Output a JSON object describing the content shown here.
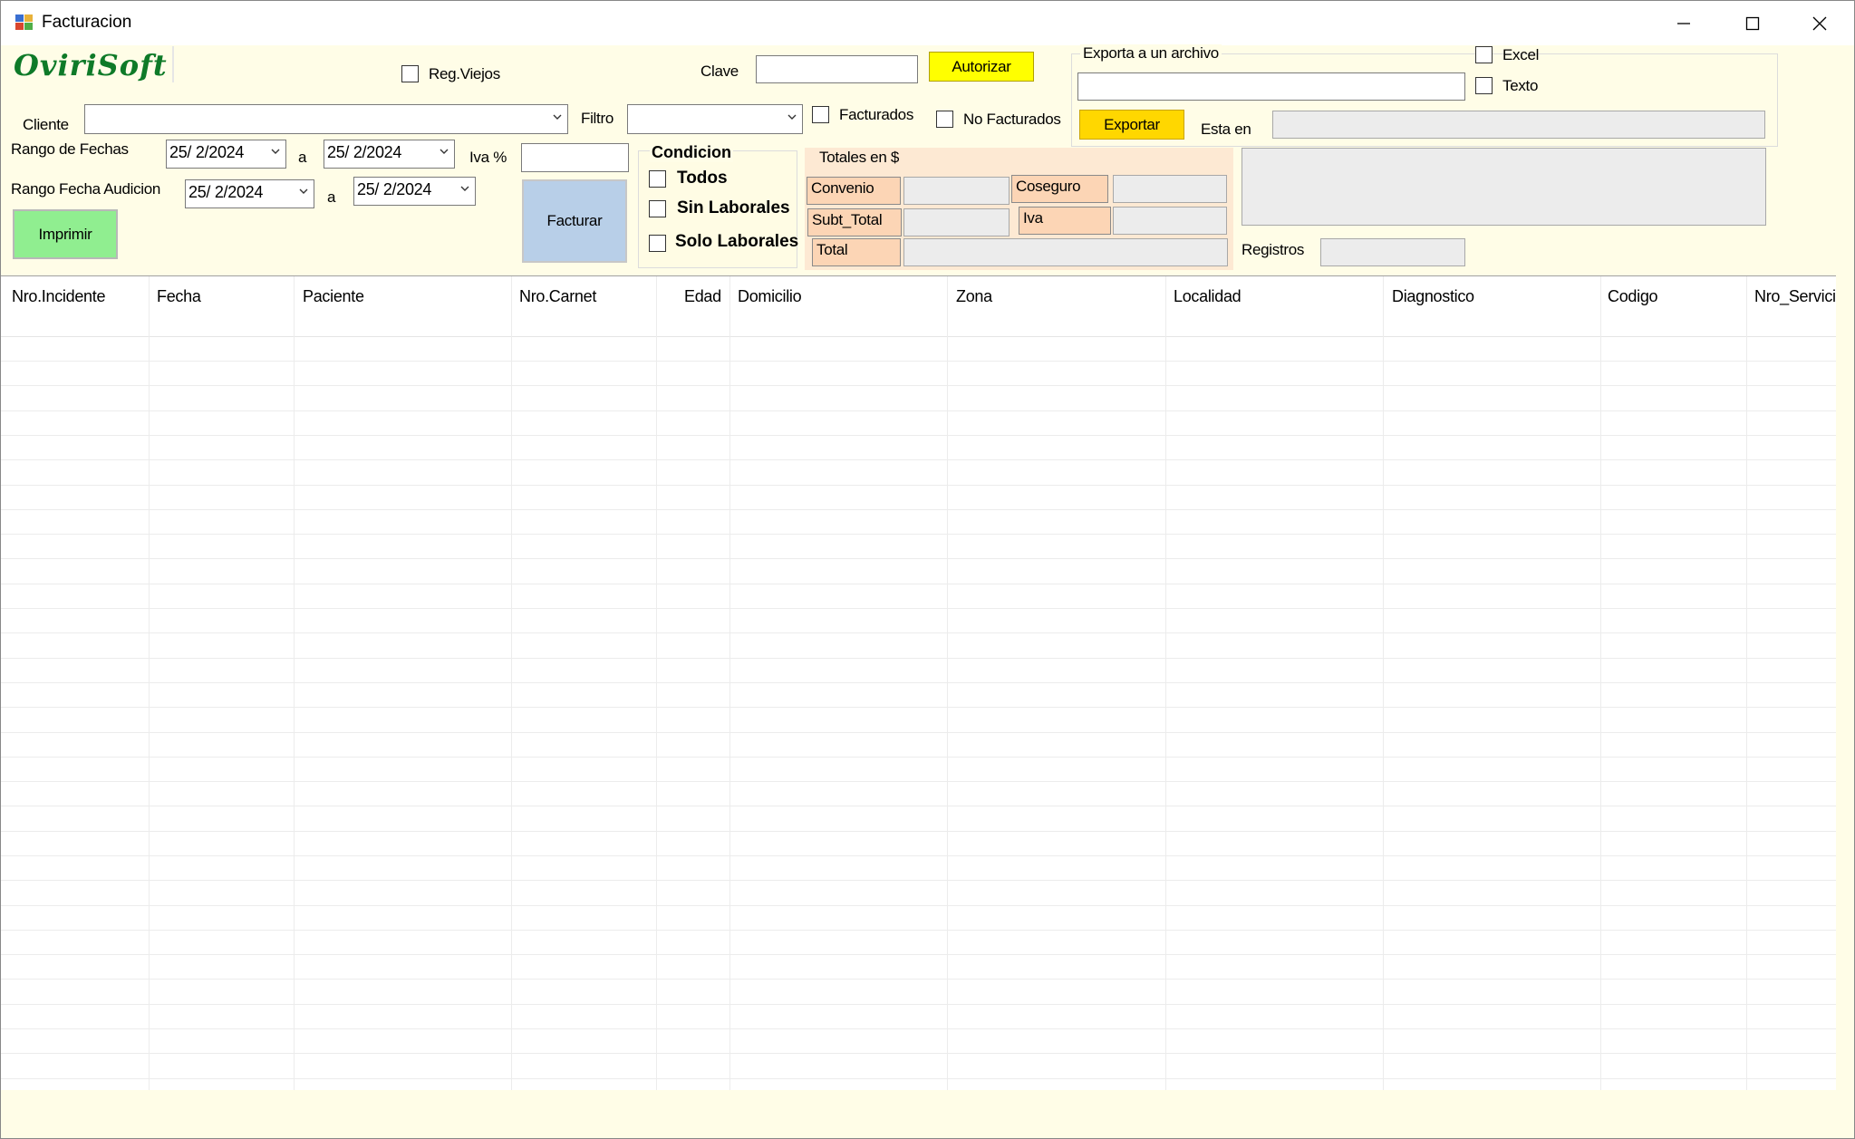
{
  "window": {
    "title": "Facturacion"
  },
  "logo": "OviriSoft",
  "top": {
    "reg_viejos": "Reg.Viejos",
    "clave_label": "Clave",
    "clave_value": "",
    "autorizar": "Autorizar"
  },
  "export": {
    "group_label": "Exporta a un archivo",
    "excel": "Excel",
    "texto": "Texto",
    "path_value": "",
    "exportar": "Exportar",
    "esta_en": "Esta en",
    "esta_en_value": ""
  },
  "filters": {
    "cliente_label": "Cliente",
    "cliente_value": "",
    "filtro_label": "Filtro",
    "filtro_value": "",
    "facturados": "Facturados",
    "no_facturados": "No Facturados",
    "rango_fechas": "Rango de Fechas",
    "fecha_desde": "25/  2/2024",
    "a": "a",
    "fecha_hasta": "25/  2/2024",
    "iva_pct_label": "Iva %",
    "iva_pct_value": "",
    "rango_audicion": "Rango Fecha Audicion",
    "aud_desde": "25/  2/2024",
    "aud_hasta": "25/  2/2024",
    "imprimir": "Imprimir",
    "facturar": "Facturar"
  },
  "condicion": {
    "title": "Condicion",
    "todos": "Todos",
    "sin_laborales": "Sin Laborales",
    "solo_laborales": "Solo Laborales"
  },
  "totales": {
    "title": "Totales en $",
    "convenio": "Convenio",
    "coseguro": "Coseguro",
    "subtotal": "Subt_Total",
    "iva": "Iva",
    "total": "Total",
    "registros": "Registros"
  },
  "grid": {
    "columns": [
      "Nro.Incidente",
      "Fecha",
      "Paciente",
      "Nro.Carnet",
      "Edad",
      "Domicilio",
      "Zona",
      "Localidad",
      "Diagnostico",
      "Codigo",
      "Nro_Servici"
    ],
    "rows": []
  },
  "colors": {
    "form_bg": "#fffde7",
    "autorizar_bg": "#ffff00",
    "exportar_bg": "#ffd700",
    "imprimir_bg": "#90ee90",
    "facturar_bg": "#b8cfe8",
    "totales_bg": "#fde9d3",
    "peach_label": "#fcd5b5",
    "logo_green": "#0e7a28"
  }
}
